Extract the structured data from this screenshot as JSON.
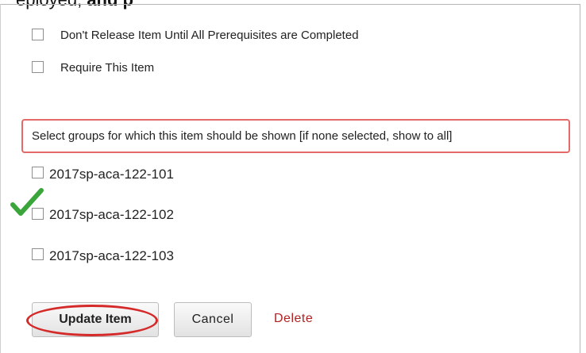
{
  "caption": {
    "prefix": "eployed,",
    "bold_suffix": "and p"
  },
  "options": [
    {
      "label": "Don't Release Item Until All Prerequisites are Completed",
      "checked": false
    },
    {
      "label": "Require This Item",
      "checked": false
    }
  ],
  "groups_section": {
    "heading": "Select groups for which this item should be shown [if none selected, show to all]",
    "groups": [
      {
        "label": "2017sp-aca-122-101",
        "checked": false
      },
      {
        "label": "2017sp-aca-122-102",
        "checked": false
      },
      {
        "label": "2017sp-aca-122-103",
        "checked": false
      }
    ]
  },
  "actions": {
    "update_label": "Update Item",
    "cancel_label": "Cancel",
    "delete_label": "Delete"
  },
  "annotations": {
    "highlight_color": "#d52a2a",
    "check_color": "#3aa53a",
    "check_icon": "green-checkmark-icon"
  }
}
